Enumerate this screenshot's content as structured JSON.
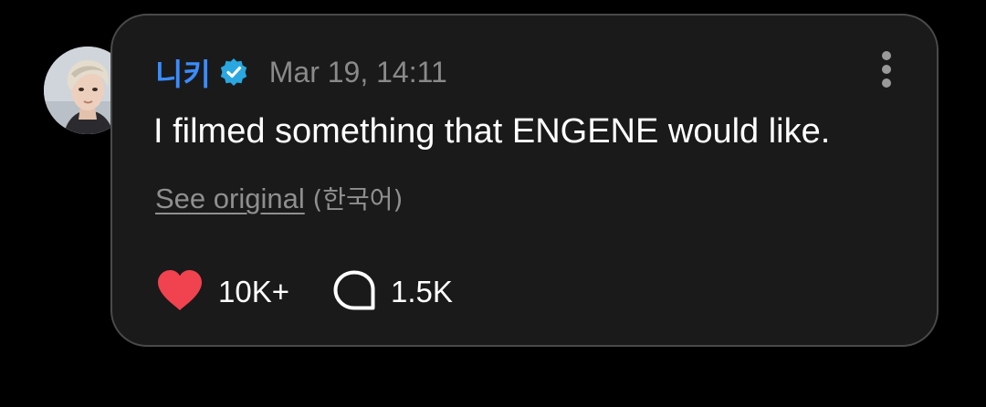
{
  "post": {
    "author": "니키",
    "timestamp": "Mar 19, 14:11",
    "text": "I filmed something that ENGENE would like.",
    "see_original_link": "See original",
    "original_language": "(한국어)",
    "likes_count": "10K+",
    "replies_count": "1.5K"
  },
  "icons": {
    "verified": "verified-badge-icon",
    "more": "more-vertical-icon",
    "like": "heart-icon",
    "reply": "speech-bubble-icon"
  },
  "colors": {
    "background": "#000000",
    "card": "#1a1a1a",
    "card_border": "#4a4a4a",
    "author": "#3a8cff",
    "verified": "#2aa7e0",
    "heart": "#f0434f",
    "muted_text": "#8a8a8a",
    "text": "#ffffff"
  }
}
